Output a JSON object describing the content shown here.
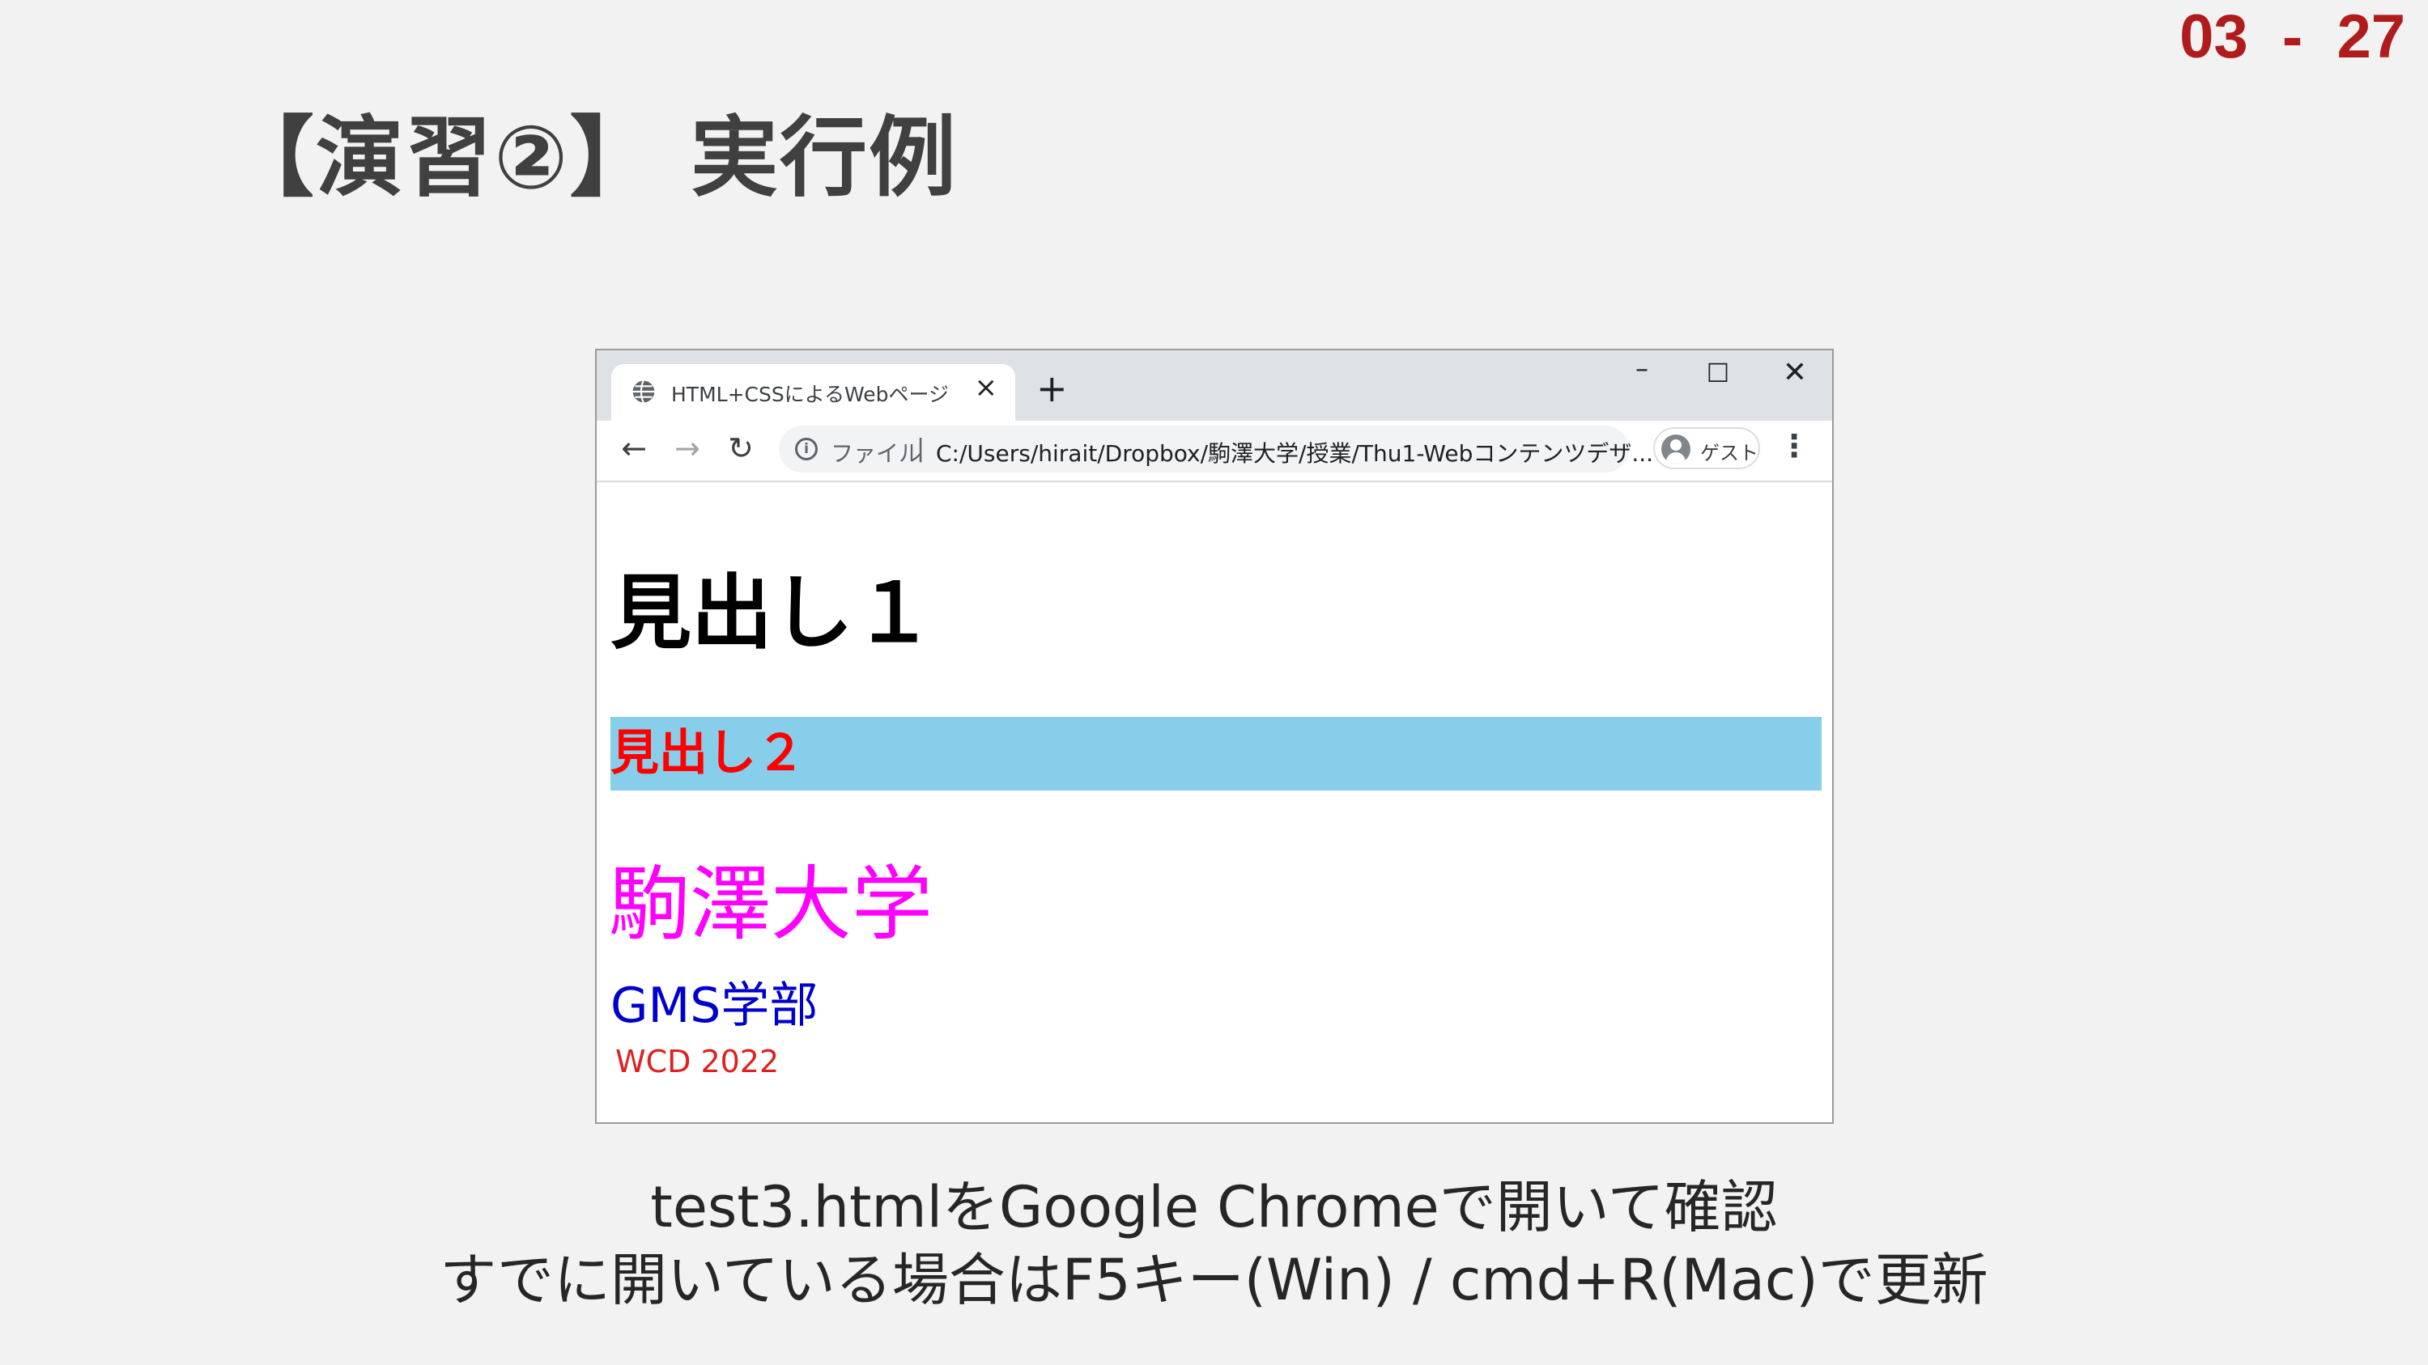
{
  "slide": {
    "page_number": "03  -  27",
    "title": "【演習②】 実行例",
    "caption_line1": "test3.htmlをGoogle Chromeで開いて確認",
    "caption_line2": "すでに開いている場合はF5キー(Win) / cmd+R(Mac)で更新"
  },
  "browser": {
    "tab": {
      "title": "HTML+CSSによるWebページ",
      "favicon": "globe-icon",
      "close": "×"
    },
    "new_tab": "+",
    "window_controls": {
      "minimize": "–",
      "maximize": "☐",
      "close": "✕"
    },
    "nav": {
      "back": "←",
      "forward": "→",
      "reload": "↻"
    },
    "omnibox": {
      "info": "i",
      "scheme_label": "ファイル",
      "separator": "|",
      "url": "C:/Users/hirait/Dropbox/駒澤大学/授業/Thu1-Webコンテンツデザ..."
    },
    "profile_label": "ゲスト",
    "menu": "⋮"
  },
  "page": {
    "h1": "見出し１",
    "h2": "見出し２",
    "university": "駒澤大学",
    "department": "GMS学部",
    "course": "WCD 2022"
  },
  "colors": {
    "page_number": "#b01c1c",
    "h2_background": "#87ceeb",
    "h2_text": "#ff0000",
    "university_text": "#ff00ff",
    "department_text": "#0000cd",
    "course_text": "#e02020"
  }
}
